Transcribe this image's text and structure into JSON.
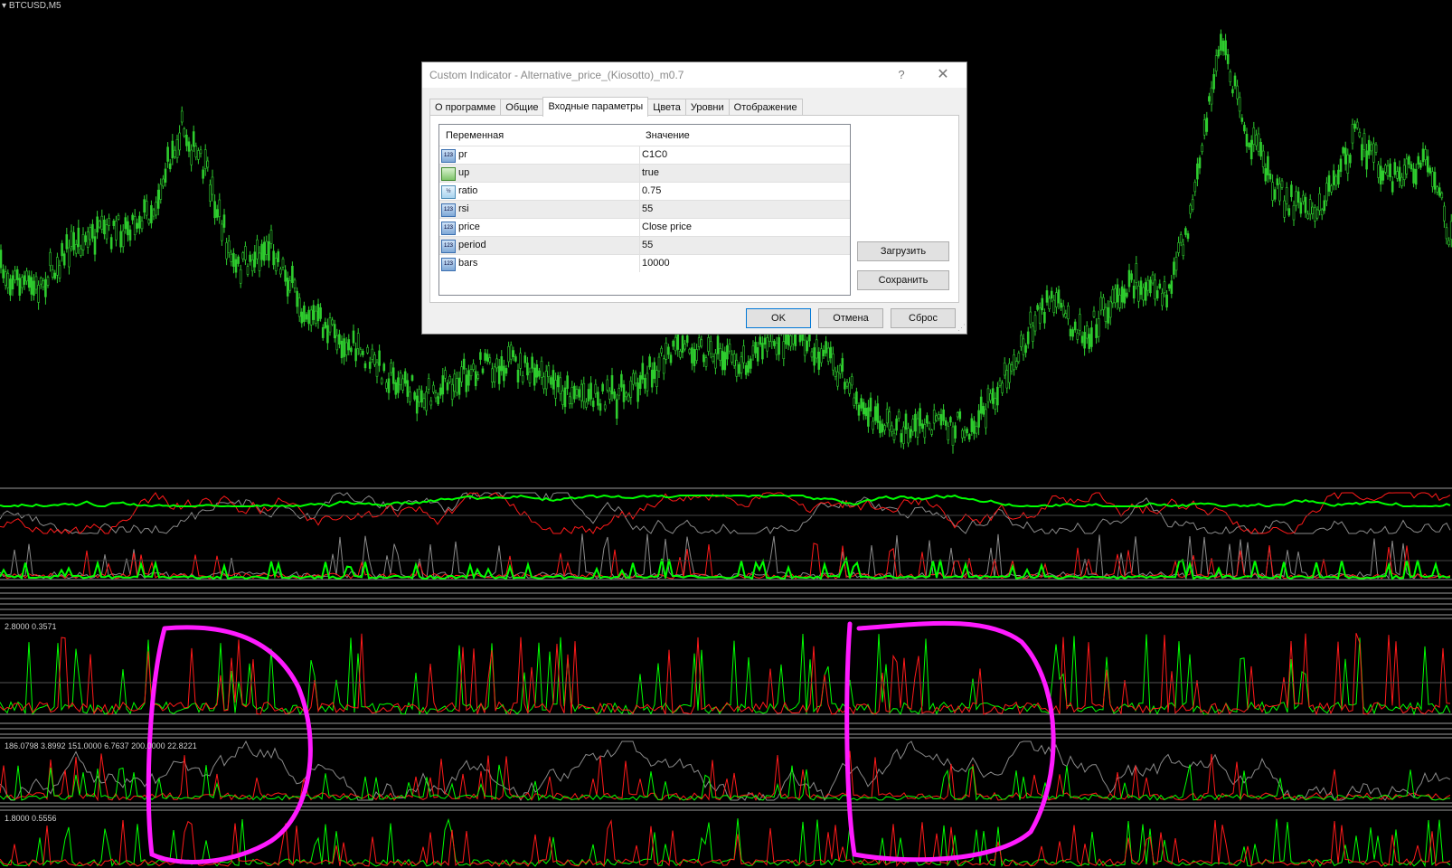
{
  "chart": {
    "symbol": "BTCUSD,M5",
    "subwindow_labels": [
      "2.8000 0.3571",
      "186.0798 3.8992 151.0000 6.7637 200.0000 22.8221",
      "1.8000 0.5556"
    ],
    "colors": {
      "candles": "#2ecc2e",
      "bull_line": "#00ff00",
      "bear_line": "#ff1a1a",
      "third_line": "#8a8a8a",
      "annotation": "#ff1aff"
    }
  },
  "dialog": {
    "title": "Custom Indicator - Alternative_price_(Kiosotto)_m0.7",
    "help": "?",
    "close": "✕",
    "tabs": [
      "О программе",
      "Общие",
      "Входные параметры",
      "Цвета",
      "Уровни",
      "Отображение"
    ],
    "active_tab": "Входные параметры",
    "grid": {
      "headers": {
        "variable": "Переменная",
        "value": "Значение"
      },
      "rows": [
        {
          "icon": "int-icon",
          "icon_text": "123",
          "name": "pr",
          "value": "C1C0"
        },
        {
          "icon": "bool-icon",
          "icon_text": "",
          "name": "up",
          "value": "true"
        },
        {
          "icon": "double-icon",
          "icon_text": "½",
          "name": "ratio",
          "value": "0.75"
        },
        {
          "icon": "int-icon",
          "icon_text": "123",
          "name": "rsi",
          "value": "55"
        },
        {
          "icon": "int-icon",
          "icon_text": "123",
          "name": "price",
          "value": "Close price"
        },
        {
          "icon": "int-icon",
          "icon_text": "123",
          "name": "period",
          "value": "55"
        },
        {
          "icon": "int-icon",
          "icon_text": "123",
          "name": "bars",
          "value": "10000"
        }
      ]
    },
    "load_button": "Загрузить",
    "save_button": "Сохранить",
    "ok_button": "OK",
    "cancel_button": "Отмена",
    "reset_button": "Сброс"
  }
}
